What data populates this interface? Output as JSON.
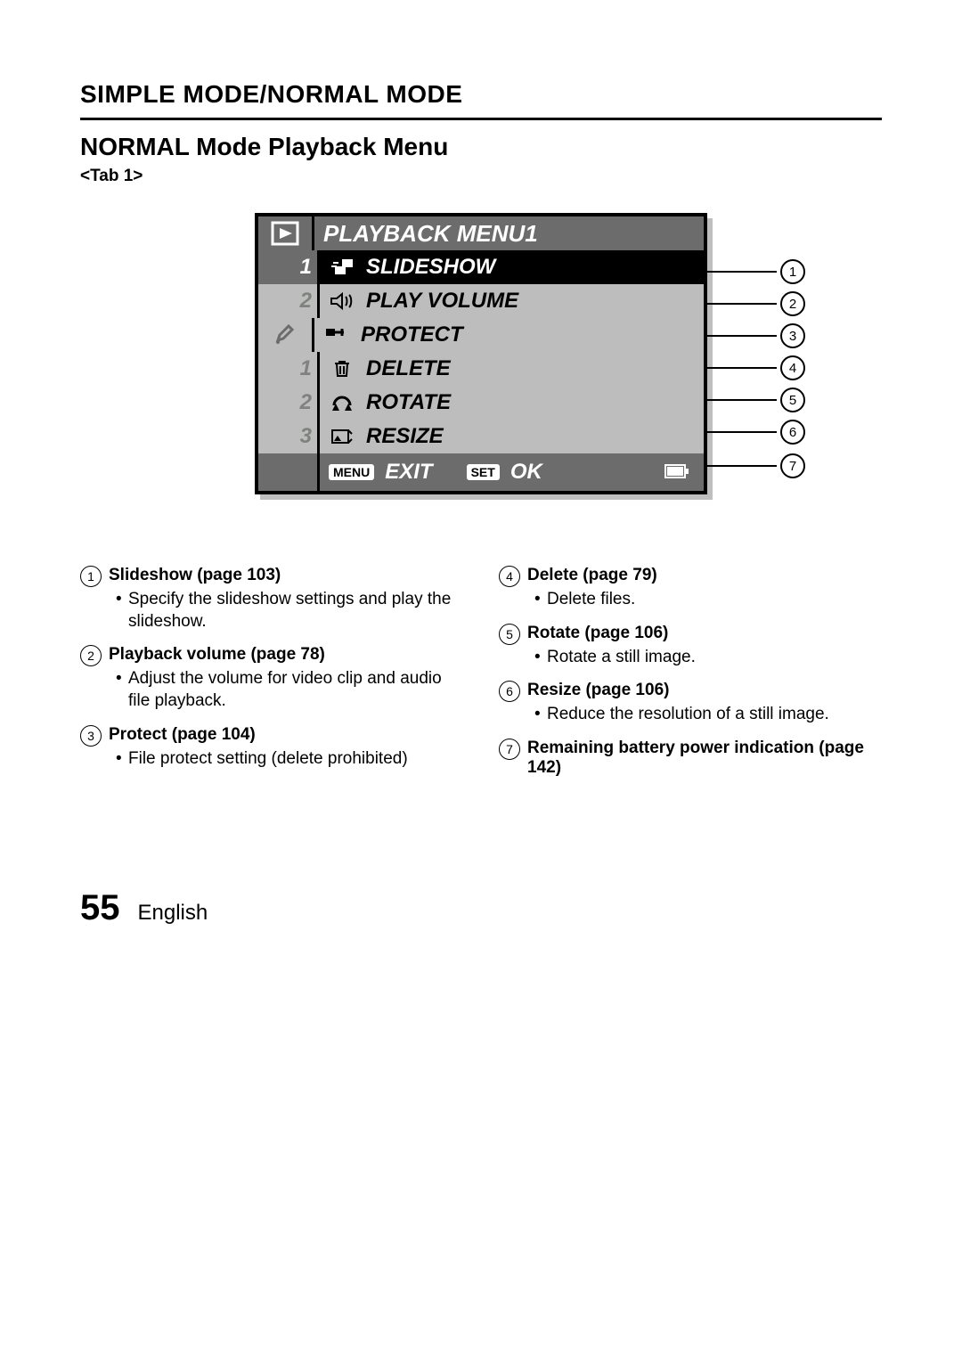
{
  "header": {
    "section": "SIMPLE MODE/NORMAL MODE",
    "subtitle": "NORMAL Mode Playback Menu",
    "tab": "<Tab 1>"
  },
  "screen": {
    "title": "PLAYBACK MENU1",
    "side_playback": {
      "num_a": "1",
      "num_b": "2"
    },
    "side_setup": {
      "num_a": "1",
      "num_b": "2",
      "num_c": "3"
    },
    "items": {
      "slideshow": "SLIDESHOW",
      "play_volume": "PLAY VOLUME",
      "protect": "PROTECT",
      "delete": "DELETE",
      "rotate": "ROTATE",
      "resize": "RESIZE"
    },
    "footer": {
      "menu_badge": "MENU",
      "exit": "EXIT",
      "set_badge": "SET",
      "ok": "OK"
    }
  },
  "descriptions": {
    "col1": {
      "d1_title": "Slideshow (page 103)",
      "d1_body": "Specify the slideshow settings and play the slideshow.",
      "d2_title": "Playback volume (page 78)",
      "d2_body": "Adjust the volume for video clip and audio file playback.",
      "d3_title": "Protect (page 104)",
      "d3_body": "File protect setting (delete prohibited)"
    },
    "col2": {
      "d4_title": "Delete (page 79)",
      "d4_body": "Delete files.",
      "d5_title": "Rotate (page 106)",
      "d5_body": "Rotate a still image.",
      "d6_title": "Resize (page 106)",
      "d6_body": "Reduce the resolution of a still image.",
      "d7_title": "Remaining battery power indication (page 142)"
    }
  },
  "callouts": {
    "c1": "1",
    "c2": "2",
    "c3": "3",
    "c4": "4",
    "c5": "5",
    "c6": "6",
    "c7": "7"
  },
  "footer": {
    "page": "55",
    "language": "English"
  }
}
